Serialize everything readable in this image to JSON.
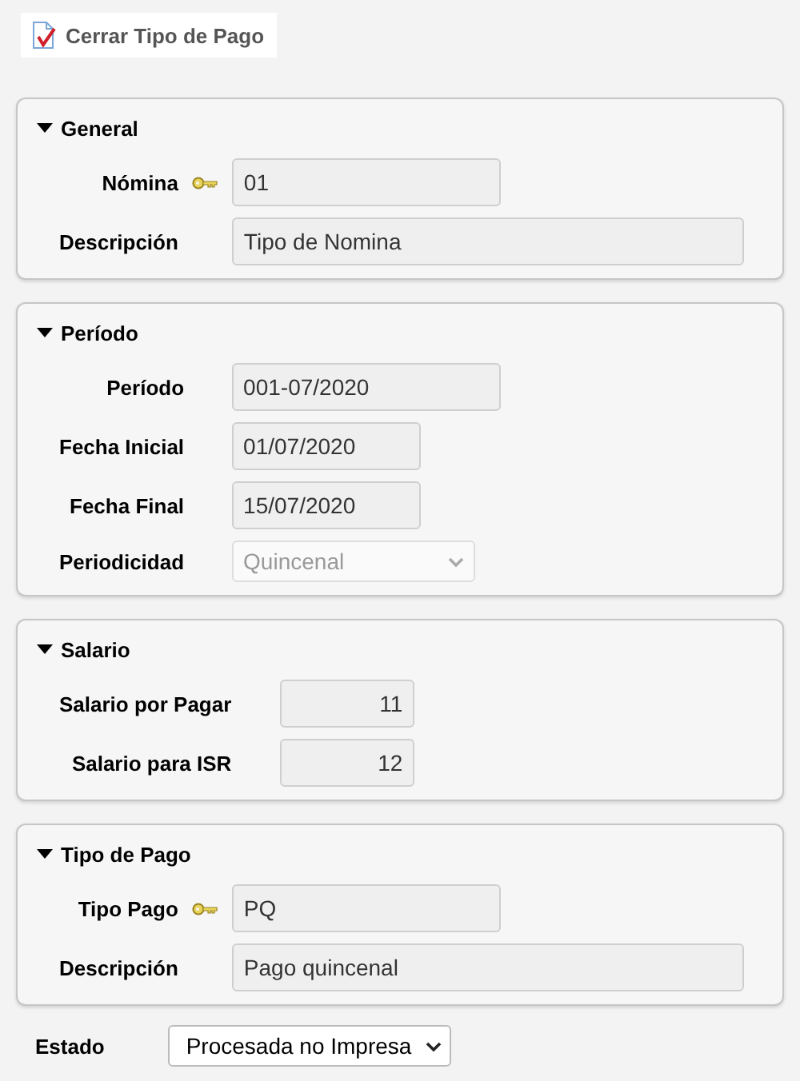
{
  "toolbar": {
    "button": "Cerrar Tipo de Pago"
  },
  "sections": [
    {
      "title": "General",
      "expanded": true,
      "fields": [
        {
          "label": "Nómina",
          "kind": "text",
          "key": true,
          "value": "01"
        },
        {
          "label": "Descripción",
          "kind": "long",
          "key": false,
          "value": "Tipo de Nomina"
        }
      ]
    },
    {
      "title": "Período",
      "expanded": true,
      "fields": [
        {
          "label": "Período",
          "kind": "text",
          "key": false,
          "value": "001-07/2020"
        },
        {
          "label": "Fecha Inicial",
          "kind": "date",
          "key": false,
          "value": "01/07/2020"
        },
        {
          "label": "Fecha Final",
          "kind": "date",
          "key": false,
          "value": "15/07/2020"
        },
        {
          "label": "Periodicidad",
          "kind": "select",
          "key": false,
          "disabled": true,
          "value": "Quincenal"
        }
      ]
    },
    {
      "title": "Salario",
      "expanded": true,
      "fields": [
        {
          "label": "Salario por Pagar",
          "kind": "number",
          "key": false,
          "value": "11"
        },
        {
          "label": "Salario para ISR",
          "kind": "number",
          "key": false,
          "value": "12"
        }
      ]
    },
    {
      "title": "Tipo de Pago",
      "expanded": true,
      "fields": [
        {
          "label": "Tipo Pago",
          "kind": "text",
          "key": true,
          "value": "PQ"
        },
        {
          "label": "Descripción",
          "kind": "long",
          "key": false,
          "value": "Pago quincenal"
        }
      ]
    }
  ],
  "status": {
    "label": "Estado",
    "value": "Procesada no Impresa",
    "disabled": false
  }
}
